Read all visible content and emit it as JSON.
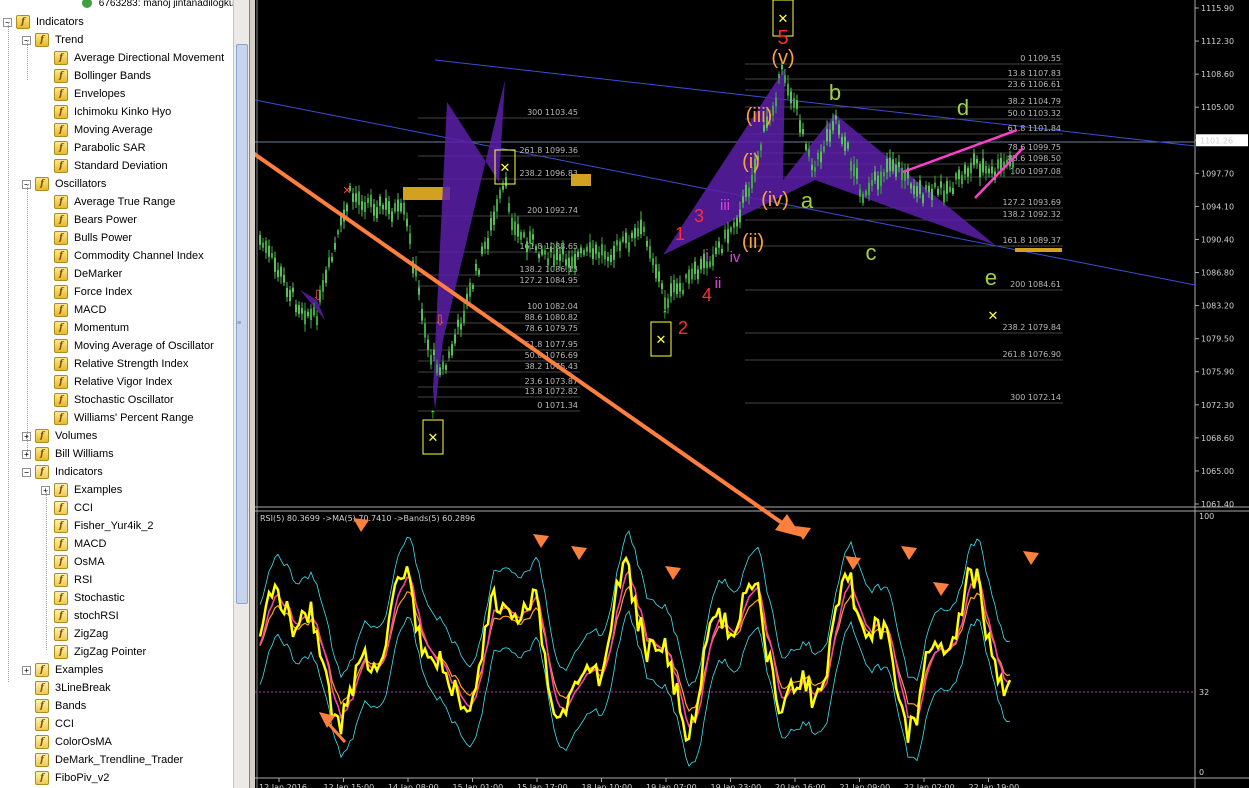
{
  "navigator": {
    "top_account": "6763283: manoj jintanadilogkul",
    "items": [
      {
        "label": "Indicators",
        "level": 0,
        "expander": "−",
        "icon": "indicator-folder-icon"
      },
      {
        "label": "Trend",
        "level": 1,
        "expander": "−",
        "icon": "indicator-folder-icon"
      },
      {
        "label": "Average Directional Movement",
        "level": 2,
        "icon": "indicator-icon"
      },
      {
        "label": "Bollinger Bands",
        "level": 2,
        "icon": "indicator-icon"
      },
      {
        "label": "Envelopes",
        "level": 2,
        "icon": "indicator-icon"
      },
      {
        "label": "Ichimoku Kinko Hyo",
        "level": 2,
        "icon": "indicator-icon"
      },
      {
        "label": "Moving Average",
        "level": 2,
        "icon": "indicator-icon"
      },
      {
        "label": "Parabolic SAR",
        "level": 2,
        "icon": "indicator-icon"
      },
      {
        "label": "Standard Deviation",
        "level": 2,
        "icon": "indicator-icon"
      },
      {
        "label": "Oscillators",
        "level": 1,
        "expander": "−",
        "icon": "indicator-folder-icon"
      },
      {
        "label": "Average True Range",
        "level": 2,
        "icon": "indicator-icon"
      },
      {
        "label": "Bears Power",
        "level": 2,
        "icon": "indicator-icon"
      },
      {
        "label": "Bulls Power",
        "level": 2,
        "icon": "indicator-icon"
      },
      {
        "label": "Commodity Channel Index",
        "level": 2,
        "icon": "indicator-icon"
      },
      {
        "label": "DeMarker",
        "level": 2,
        "icon": "indicator-icon"
      },
      {
        "label": "Force Index",
        "level": 2,
        "icon": "indicator-icon"
      },
      {
        "label": "MACD",
        "level": 2,
        "icon": "indicator-icon"
      },
      {
        "label": "Momentum",
        "level": 2,
        "icon": "indicator-icon"
      },
      {
        "label": "Moving Average of Oscillator",
        "level": 2,
        "icon": "indicator-icon"
      },
      {
        "label": "Relative Strength Index",
        "level": 2,
        "icon": "indicator-icon"
      },
      {
        "label": "Relative Vigor Index",
        "level": 2,
        "icon": "indicator-icon"
      },
      {
        "label": "Stochastic Oscillator",
        "level": 2,
        "icon": "indicator-icon"
      },
      {
        "label": "Williams' Percent Range",
        "level": 2,
        "icon": "indicator-icon"
      },
      {
        "label": "Volumes",
        "level": 1,
        "expander": "+",
        "icon": "indicator-folder-icon"
      },
      {
        "label": "Bill Williams",
        "level": 1,
        "expander": "+",
        "icon": "indicator-folder-icon"
      },
      {
        "label": "Indicators",
        "level": 1,
        "expander": "−",
        "icon": "custom-indicator-folder-icon"
      },
      {
        "label": "Examples",
        "level": 2,
        "expander": "+",
        "icon": "custom-indicator-folder-icon"
      },
      {
        "label": "CCI",
        "level": 2,
        "icon": "custom-indicator-icon"
      },
      {
        "label": "Fisher_Yur4ik_2",
        "level": 2,
        "icon": "custom-indicator-icon"
      },
      {
        "label": "MACD",
        "level": 2,
        "icon": "custom-indicator-icon"
      },
      {
        "label": "OsMA",
        "level": 2,
        "icon": "custom-indicator-icon"
      },
      {
        "label": "RSI",
        "level": 2,
        "icon": "custom-indicator-icon"
      },
      {
        "label": "Stochastic",
        "level": 2,
        "icon": "custom-indicator-icon"
      },
      {
        "label": "stochRSI",
        "level": 2,
        "icon": "custom-indicator-icon"
      },
      {
        "label": "ZigZag",
        "level": 2,
        "icon": "custom-indicator-icon"
      },
      {
        "label": "ZigZag Pointer",
        "level": 2,
        "icon": "custom-indicator-icon"
      },
      {
        "label": "Examples",
        "level": 1,
        "expander": "+",
        "icon": "custom-indicator-folder-icon"
      },
      {
        "label": "3LineBreak",
        "level": 1,
        "icon": "custom-indicator-icon"
      },
      {
        "label": "Bands",
        "level": 1,
        "icon": "custom-indicator-icon"
      },
      {
        "label": "CCI",
        "level": 1,
        "icon": "custom-indicator-icon"
      },
      {
        "label": "ColorOsMA",
        "level": 1,
        "icon": "custom-indicator-icon"
      },
      {
        "label": "DeMark_Trendline_Trader",
        "level": 1,
        "icon": "custom-indicator-icon"
      },
      {
        "label": "FiboPiv_v2",
        "level": 1,
        "icon": "custom-indicator-icon"
      }
    ]
  },
  "chart": {
    "colors": {
      "background": "#000000",
      "bull": "#3fa53f",
      "bear": "#58c058",
      "fib": "#c8c8c8",
      "channel": "#3a4fd6",
      "harmonic": "#5a1fa8",
      "annotation": "#ff7f3f",
      "current_price_line": "#8fa8c8"
    },
    "price_axis_labels": [
      "1115.90",
      "1112.30",
      "1108.60",
      "1105.00",
      "1101.26",
      "1097.70",
      "1094.10",
      "1090.40",
      "1086.80",
      "1083.20",
      "1079.50",
      "1075.90",
      "1072.30",
      "1068.60",
      "1065.00",
      "1061.40"
    ],
    "current_price": "1101.26",
    "time_axis_labels": [
      "12 Jan 2016",
      "12 Jan 15:00",
      "14 Jan 08:00",
      "15 Jan 01:00",
      "15 Jan 17:00",
      "18 Jan 10:00",
      "19 Jan 07:00",
      "19 Jan 23:00",
      "20 Jan 16:00",
      "21 Jan 09:00",
      "22 Jan 02:00",
      "22 Jan 19:00"
    ],
    "fib_labels_left": [
      "300 1103.45",
      "261.8 1099.36",
      "238.2 1096.83",
      "200 1092.74",
      "161.8 1088.65",
      "138.2 1086.13",
      "127.2 1084.95",
      "100 1082.04",
      "88.6 1080.82",
      "78.6 1079.75",
      "61.8 1077.95",
      "50.0 1076.69",
      "38.2 1075.43",
      "23.6 1073.87",
      "13.8 1072.82",
      "0 1071.34"
    ],
    "fib_labels_right": [
      "0 1109.55",
      "13.8 1107.83",
      "23.6 1106.61",
      "38.2 1104.79",
      "50.0 1103.32",
      "61.8 1101.84",
      "78.6 1099.75",
      "88.6 1098.50",
      "100 1097.08",
      "127.2 1093.69",
      "138.2 1092.32",
      "161.8 1089.37",
      "200 1084.61",
      "238.2 1079.84",
      "261.8 1076.90",
      "300 1072.14"
    ],
    "wave_labels": {
      "w5": "5",
      "wv": "(v)",
      "wiii": "(iii)",
      "wi_paren": "(i)",
      "wiv": "(iv)",
      "wii_paren": "(ii)",
      "a": "a",
      "b": "b",
      "c": "c",
      "d": "d",
      "e": "e",
      "n1": "1",
      "n2": "2",
      "n3": "3",
      "n4": "4",
      "ri": "i",
      "rii": "ii",
      "riii": "iii",
      "riv": "iv"
    }
  },
  "rsi_panel": {
    "header": "RSI(5) 80.3699  ->MA(5) 70.7410  ->Bands(5) 60.2896",
    "levels": {
      "top": "100",
      "mid": "32",
      "bottom": "0"
    },
    "colors": {
      "rsi": "#ffff00",
      "ma": "#ff3fa8",
      "ma2": "#ff9f1f",
      "bands": "#40e0f0",
      "level": "#b03fb0"
    }
  }
}
